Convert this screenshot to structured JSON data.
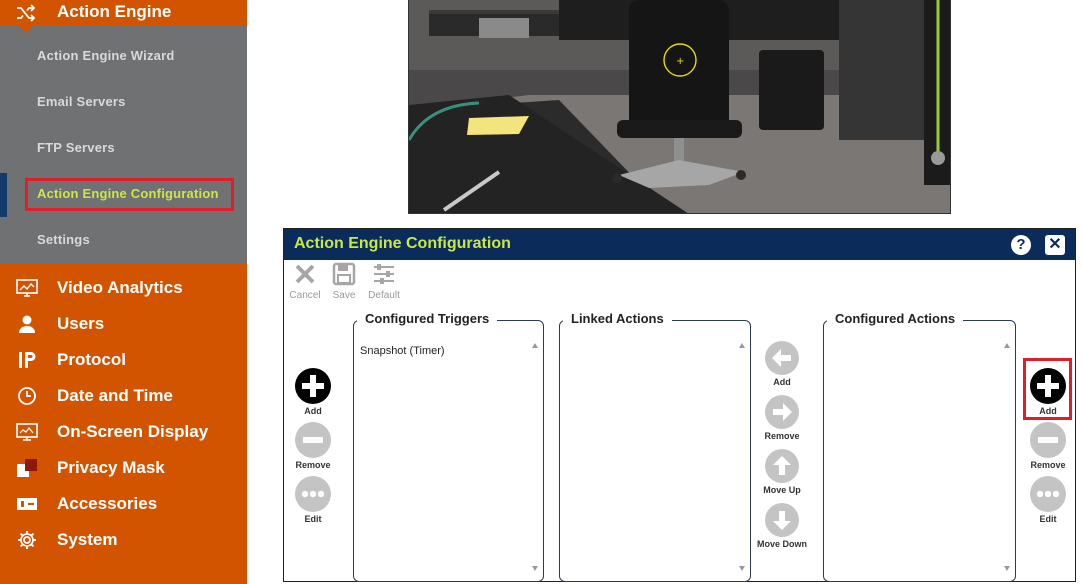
{
  "sidebar": {
    "header": {
      "title": "Action Engine",
      "icon": "shuffle-icon"
    },
    "submenu": [
      {
        "label": "Action Engine Wizard"
      },
      {
        "label": "Email Servers"
      },
      {
        "label": "FTP Servers"
      },
      {
        "label": "Action Engine Configuration",
        "active": true
      },
      {
        "label": "Settings"
      }
    ],
    "menu": [
      {
        "label": "Video Analytics",
        "icon": "monitor-chart-icon"
      },
      {
        "label": "Users",
        "icon": "user-icon"
      },
      {
        "label": "Protocol",
        "icon": "ip-icon"
      },
      {
        "label": "Date and Time",
        "icon": "clock-icon"
      },
      {
        "label": "On-Screen Display",
        "icon": "display-icon"
      },
      {
        "label": "Privacy Mask",
        "icon": "privacy-mask-icon"
      },
      {
        "label": "Accessories",
        "icon": "accessories-icon"
      },
      {
        "label": "System",
        "icon": "gear-icon"
      }
    ]
  },
  "dialog": {
    "title": "Action Engine Configuration",
    "help_icon": "?",
    "close_icon": "✕",
    "toolbar": {
      "cancel": "Cancel",
      "save": "Save",
      "default": "Default"
    },
    "panels": {
      "triggers": {
        "title": "Configured Triggers",
        "items": [
          "Snapshot (Timer)"
        ]
      },
      "linked": {
        "title": "Linked Actions",
        "items": []
      },
      "actions": {
        "title": "Configured Actions",
        "items": []
      }
    },
    "left_buttons": {
      "add": "Add",
      "remove": "Remove",
      "edit": "Edit"
    },
    "middle_buttons": {
      "add": "Add",
      "remove": "Remove",
      "move_up": "Move Up",
      "move_down": "Move Down"
    },
    "right_buttons": {
      "add": "Add",
      "remove": "Remove",
      "edit": "Edit"
    }
  },
  "colors": {
    "sidebar_orange": "#d35400",
    "submenu_gray": "#6f7173",
    "active_green": "#c8e84a",
    "dialog_navy": "#0b2b5a",
    "highlight_red": "#e11d2a"
  }
}
